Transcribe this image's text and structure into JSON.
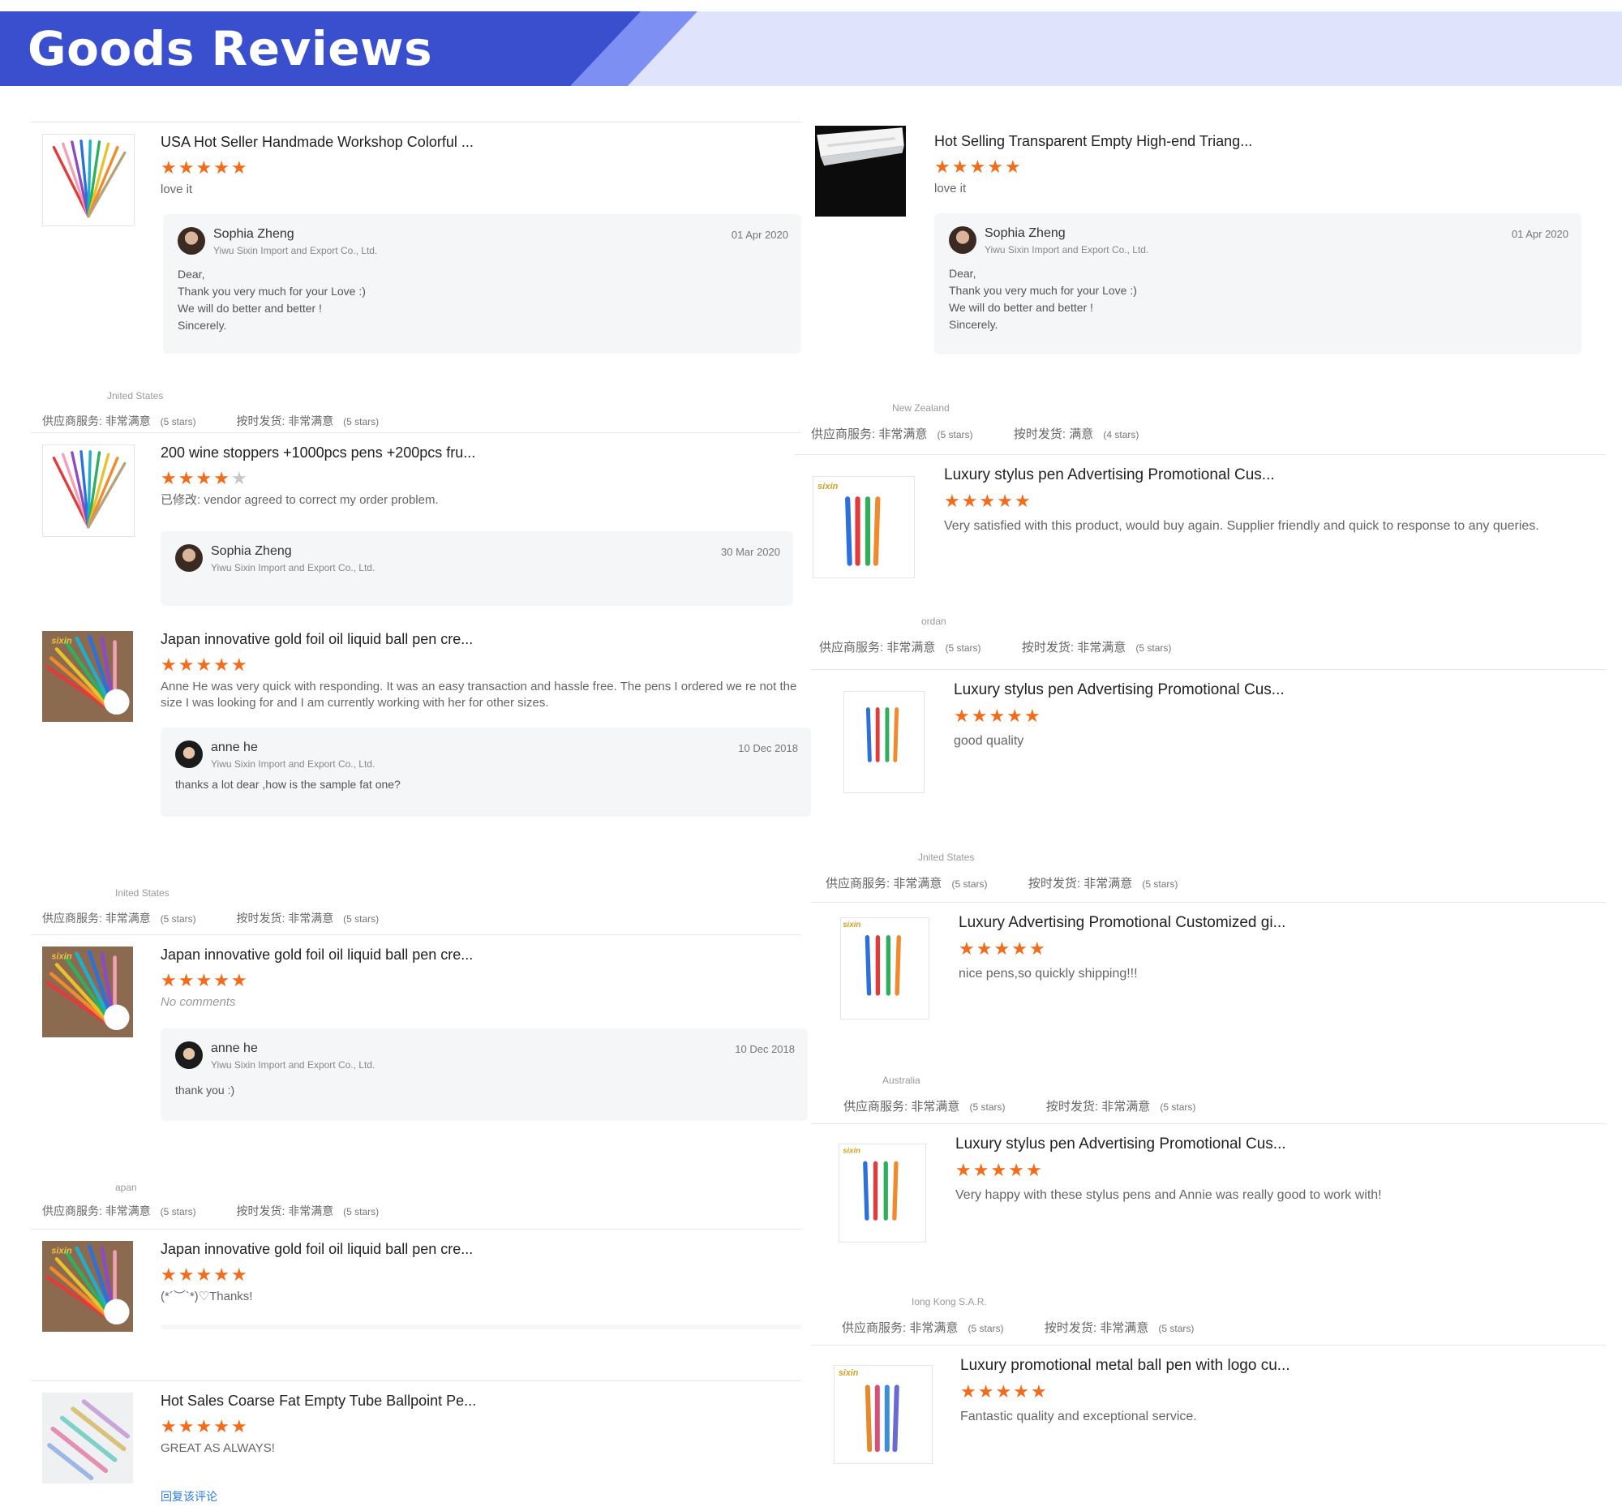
{
  "header": {
    "title": "Goods Reviews"
  },
  "labels": {
    "supplier_service": "供应商服务:",
    "on_time": "按时发货:",
    "reply_link": "回复该评论"
  },
  "colors": {
    "star": "#f26c1b",
    "banner_dark": "#3a4fce",
    "banner_light": "#7d8ff3",
    "banner_bg": "#dfe3fb"
  },
  "left": [
    {
      "title": "USA Hot Seller Handmade Workshop Colorful ...",
      "image_icon": "colored-pen-fan",
      "rating": 5,
      "text": "love it",
      "reply": {
        "name": "Sophia Zheng",
        "company": "Yiwu Sixin Import and Export Co., Ltd.",
        "date": "01 Apr 2020",
        "message": "Dear,\nThank you very much for your Love :)\nWe will do better and better !\nSincerely."
      },
      "country": "Jnited States",
      "supplier_value": "非常满意",
      "supplier_stars": "(5 stars)",
      "ontime_value": "非常满意",
      "ontime_stars": "(5 stars)"
    },
    {
      "title": "200 wine stoppers +1000pcs pens +200pcs fru...",
      "image_icon": "colored-pen-fan",
      "rating": 4,
      "text": "已修改: vendor agreed to correct my order problem.",
      "reply": {
        "name": "Sophia Zheng",
        "company": "Yiwu Sixin Import and Export Co., Ltd.",
        "date": "30 Mar 2020",
        "message": ""
      }
    },
    {
      "title": "Japan innovative gold foil oil liquid ball pen cre...",
      "image_icon": "glitter-pen-fan",
      "rating": 5,
      "text": "Anne He was very quick with responding. It was an easy transaction and hassle free. The pens I ordered we re not the size I was looking for and I am currently working with her for other sizes.",
      "reply": {
        "name": "anne he",
        "company": "Yiwu Sixin Import and Export Co., Ltd.",
        "date": "10 Dec 2018",
        "message": "thanks a lot dear ,how is the sample fat one?"
      },
      "country": "Inited States",
      "supplier_value": "非常满意",
      "supplier_stars": "(5 stars)",
      "ontime_value": "非常满意",
      "ontime_stars": "(5 stars)"
    },
    {
      "title": "Japan innovative gold foil oil liquid ball pen cre...",
      "image_icon": "glitter-pen-fan",
      "rating": 5,
      "text": "No comments",
      "reply": {
        "name": "anne he",
        "company": "Yiwu Sixin Import and Export Co., Ltd.",
        "date": "10 Dec 2018",
        "message": "thank you :)"
      },
      "country": "apan",
      "supplier_value": "非常满意",
      "supplier_stars": "(5 stars)",
      "ontime_value": "非常满意",
      "ontime_stars": "(5 stars)"
    },
    {
      "title": "Japan innovative gold foil oil liquid ball pen cre...",
      "image_icon": "glitter-pen-fan",
      "rating": 5,
      "text": "(*´︶`*)♡Thanks!"
    },
    {
      "title": "Hot Sales Coarse Fat Empty Tube Ballpoint Pe...",
      "image_icon": "empty-tube-pens",
      "rating": 5,
      "text": "GREAT AS ALWAYS!"
    }
  ],
  "right": [
    {
      "title": "Hot Selling Transparent Empty High-end Triang...",
      "image_icon": "clear-pen-box",
      "rating": 5,
      "text": "love it",
      "reply": {
        "name": "Sophia Zheng",
        "company": "Yiwu Sixin Import and Export Co., Ltd.",
        "date": "01 Apr 2020",
        "message": "Dear,\nThank you very much for your Love :)\nWe will do better and better !\nSincerely."
      },
      "country": "New Zealand",
      "supplier_value": "非常满意",
      "supplier_stars": "(5 stars)",
      "ontime_value": "满意",
      "ontime_stars": "(4 stars)"
    },
    {
      "title": "Luxury stylus pen Advertising Promotional Cus...",
      "image_icon": "stylus-pens",
      "rating": 5,
      "text": "Very satisfied with this product, would buy again. Supplier friendly and quick to response to any queries.",
      "country": "ordan",
      "supplier_value": "非常满意",
      "supplier_stars": "(5 stars)",
      "ontime_value": "非常满意",
      "ontime_stars": "(5 stars)"
    },
    {
      "title": "Luxury stylus pen Advertising Promotional Cus...",
      "image_icon": "stylus-pens",
      "rating": 5,
      "text": "good quality",
      "country": "Jnited States",
      "supplier_value": "非常满意",
      "supplier_stars": "(5 stars)",
      "ontime_value": "非常满意",
      "ontime_stars": "(5 stars)"
    },
    {
      "title": "Luxury Advertising Promotional Customized gi...",
      "image_icon": "stylus-pens",
      "rating": 5,
      "text": "nice pens,so quickly shipping!!!",
      "country": "Australia",
      "supplier_value": "非常满意",
      "supplier_stars": "(5 stars)",
      "ontime_value": "非常满意",
      "ontime_stars": "(5 stars)"
    },
    {
      "title": "Luxury stylus pen Advertising Promotional Cus...",
      "image_icon": "stylus-pens",
      "rating": 5,
      "text": "Very happy with these stylus pens and Annie was really good to work with!",
      "country": "Iong Kong S.A.R.",
      "supplier_value": "非常满意",
      "supplier_stars": "(5 stars)",
      "ontime_value": "非常满意",
      "ontime_stars": "(5 stars)"
    },
    {
      "title": "Luxury promotional metal ball pen with logo cu...",
      "image_icon": "stylus-pens",
      "rating": 5,
      "text": "Fantastic quality and exceptional service."
    }
  ]
}
